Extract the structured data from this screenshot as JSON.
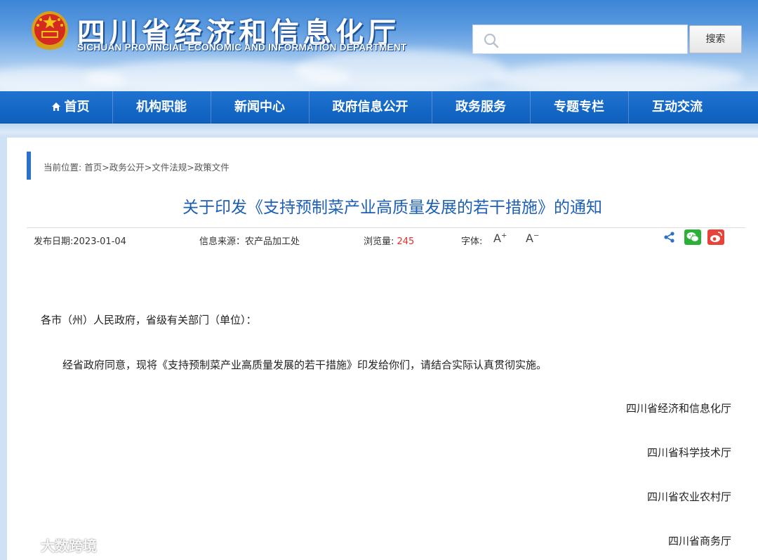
{
  "header": {
    "title_cn": "四川省经济和信息化厅",
    "title_en": "SICHUAN PROVINCIAL ECONOMIC AND INFORMATION DEPARTMENT",
    "search_placeholder": "",
    "search_button": "搜索"
  },
  "nav": {
    "items": [
      {
        "label": "首页",
        "icon": "home-icon"
      },
      {
        "label": "机构职能"
      },
      {
        "label": "新闻中心"
      },
      {
        "label": "政府信息公开"
      },
      {
        "label": "政务服务"
      },
      {
        "label": "专题专栏"
      },
      {
        "label": "互动交流"
      }
    ]
  },
  "breadcrumb": {
    "prefix": "当前位置: ",
    "items": [
      "首页",
      "政务公开",
      "文件法规",
      "政策文件"
    ],
    "separator": ">"
  },
  "article": {
    "title": "关于印发《支持预制菜产业高质量发展的若干措施》的通知",
    "publish_date": "发布日期:2023-01-04",
    "source": "信息来源：农产品加工处",
    "views_label": "浏览量: ",
    "views_value": "245",
    "font_label": "字体:",
    "font_increase": "A",
    "font_decrease": "A",
    "salutation": "各市（州）人民政府，省级有关部门（单位）：",
    "body": "经省政府同意，现将《支持预制菜产业高质量发展的若干措施》印发给你们，请结合实际认真贯彻实施。",
    "signers": [
      "四川省经济和信息化厅",
      "四川省科学技术厅",
      "四川省农业农村厅",
      "四川省商务厅"
    ]
  },
  "watermark": "大数跨境",
  "colors": {
    "nav_bg": "#1266c6",
    "title_blue": "#1c5fb4",
    "views_red": "#e0322b",
    "accent_bar": "#2b71c9"
  }
}
